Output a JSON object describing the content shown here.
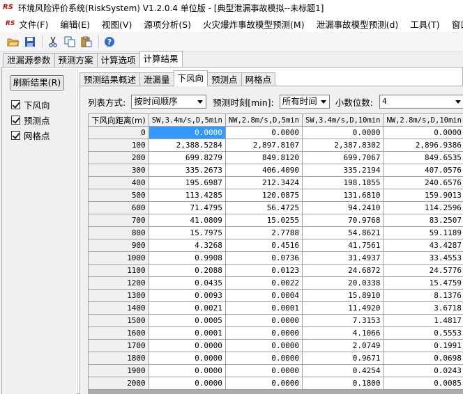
{
  "window": {
    "title": "环境风险评价系统(RiskSystem) V1.2.0.4 单位版 - [典型泄漏事故模拟--未标题1]"
  },
  "menu": {
    "icon": "app-logo-icon",
    "items": [
      "文件(F)",
      "编辑(E)",
      "视图(V)",
      "源项分析(S)",
      "火灾爆炸事故模型预测(M)",
      "泄漏事故模型预测(d)",
      "工具(T)",
      "窗口"
    ]
  },
  "toolbar": {
    "icons": [
      "open-folder-icon",
      "save-icon",
      "cut-icon",
      "copy-icon",
      "paste-icon",
      "help-icon"
    ]
  },
  "outer_tabs": [
    "泄漏源参数",
    "预测方案",
    "计算选项",
    "计算结果"
  ],
  "outer_active_tab": "计算结果",
  "side": {
    "refresh_label": "刷新结果(R)",
    "checkboxes": [
      {
        "label": "下风向",
        "checked": true
      },
      {
        "label": "预测点",
        "checked": true
      },
      {
        "label": "网格点",
        "checked": true
      }
    ]
  },
  "inner_tabs": [
    "预测结果概述",
    "泄漏量",
    "下风向",
    "预测点",
    "网格点"
  ],
  "inner_active_tab": "下风向",
  "filters": {
    "list_mode_label": "列表方式:",
    "list_mode_value": "按时间顺序",
    "time_label": "预测时刻[min]:",
    "time_value": "所有时间",
    "decimals_label": "小数位数:",
    "decimals_value": "4"
  },
  "table": {
    "headers": [
      "下风向距离(m)",
      "SW,3.4m/s,D,5min",
      "NW,2.8m/s,D,5min",
      "SW,3.4m/s,D,10min",
      "NW,2.8m/s,D,10min"
    ],
    "rows": [
      [
        "0",
        "0.0000",
        "0.0000",
        "0.0000",
        "0.0000"
      ],
      [
        "100",
        "2,388.5284",
        "2,897.8107",
        "2,387.8302",
        "2,896.9386"
      ],
      [
        "200",
        "699.8279",
        "849.8120",
        "699.7067",
        "849.6535"
      ],
      [
        "300",
        "335.2673",
        "406.4090",
        "335.2194",
        "407.0576"
      ],
      [
        "400",
        "195.6987",
        "212.3424",
        "198.1855",
        "240.6576"
      ],
      [
        "500",
        "113.4285",
        "120.0875",
        "131.6810",
        "159.9013"
      ],
      [
        "600",
        "71.4795",
        "56.4725",
        "94.2410",
        "114.2596"
      ],
      [
        "700",
        "41.0809",
        "15.0255",
        "70.9768",
        "83.2507"
      ],
      [
        "800",
        "15.7975",
        "2.7788",
        "54.8621",
        "59.1189"
      ],
      [
        "900",
        "4.3268",
        "0.4516",
        "41.7561",
        "43.4287"
      ],
      [
        "1000",
        "0.9908",
        "0.0736",
        "31.4937",
        "33.4553"
      ],
      [
        "1100",
        "0.2088",
        "0.0123",
        "24.6872",
        "24.5776"
      ],
      [
        "1200",
        "0.0435",
        "0.0022",
        "20.0338",
        "15.4759"
      ],
      [
        "1300",
        "0.0093",
        "0.0004",
        "15.8910",
        "8.1376"
      ],
      [
        "1400",
        "0.0021",
        "0.0001",
        "11.4920",
        "3.6718"
      ],
      [
        "1500",
        "0.0005",
        "0.0000",
        "7.3153",
        "1.4817"
      ],
      [
        "1600",
        "0.0001",
        "0.0000",
        "4.1066",
        "0.5553"
      ],
      [
        "1700",
        "0.0000",
        "0.0000",
        "2.0749",
        "0.1991"
      ],
      [
        "1800",
        "0.0000",
        "0.0000",
        "0.9671",
        "0.0698"
      ],
      [
        "1900",
        "0.0000",
        "0.0000",
        "0.4254",
        "0.0243"
      ],
      [
        "2000",
        "0.0000",
        "0.0000",
        "0.1800",
        "0.0085"
      ]
    ]
  }
}
